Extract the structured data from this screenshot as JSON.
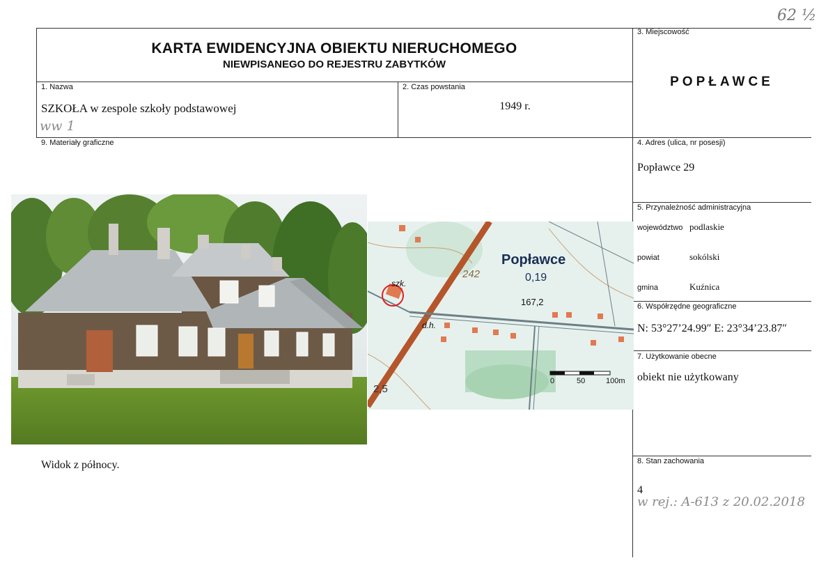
{
  "header": {
    "title_line1": "KARTA EWIDENCYJNA OBIEKTU NIERUCHOMEGO",
    "title_line2": "NIEWPISANEGO DO REJESTRU ZABYTKÓW",
    "corner_number": "62 ½"
  },
  "fields": {
    "miejscowosc": {
      "label": "3. Miejscowość",
      "value": "POPŁAWCE"
    },
    "nazwa": {
      "label": "1. Nazwa",
      "value": "SZKOŁA w zespole szkoły podstawowej",
      "handwritten": "ww 1"
    },
    "czas": {
      "label": "2. Czas powstania",
      "value": "1949 r."
    },
    "materialy": {
      "label": "9. Materiały graficzne",
      "caption": "Widok z północy."
    },
    "adres": {
      "label": "4. Adres (ulica, nr posesji)",
      "value": "Popławce 29"
    },
    "przynaleznosc": {
      "label": "5. Przynależność administracyjna",
      "wojewodztwo_label": "województwo",
      "wojewodztwo": "podlaskie",
      "powiat_label": "powiat",
      "powiat": "sokólski",
      "gmina_label": "gmina",
      "gmina": "Kuźnica"
    },
    "wspolrzedne": {
      "label": "6. Współrzędne geograficzne",
      "value": "N: 53°27’24.99″ E: 23°34’23.87″"
    },
    "uzytkowanie": {
      "label": "7. Użytkowanie obecne",
      "value": "obiekt nie użytkowany"
    },
    "stan": {
      "label": "8. Stan zachowania",
      "value": "4",
      "handwritten_note": "w rej.: A-613 z 20.02.2018"
    }
  },
  "map": {
    "place_name": "Popławce",
    "area": "0,19",
    "elev_242": "242",
    "elev_167": "167,2",
    "elev_25": "2,5",
    "szk": "szk.",
    "dh": "d.h.",
    "scale_0": "0",
    "scale_50": "50",
    "scale_100": "100m"
  }
}
